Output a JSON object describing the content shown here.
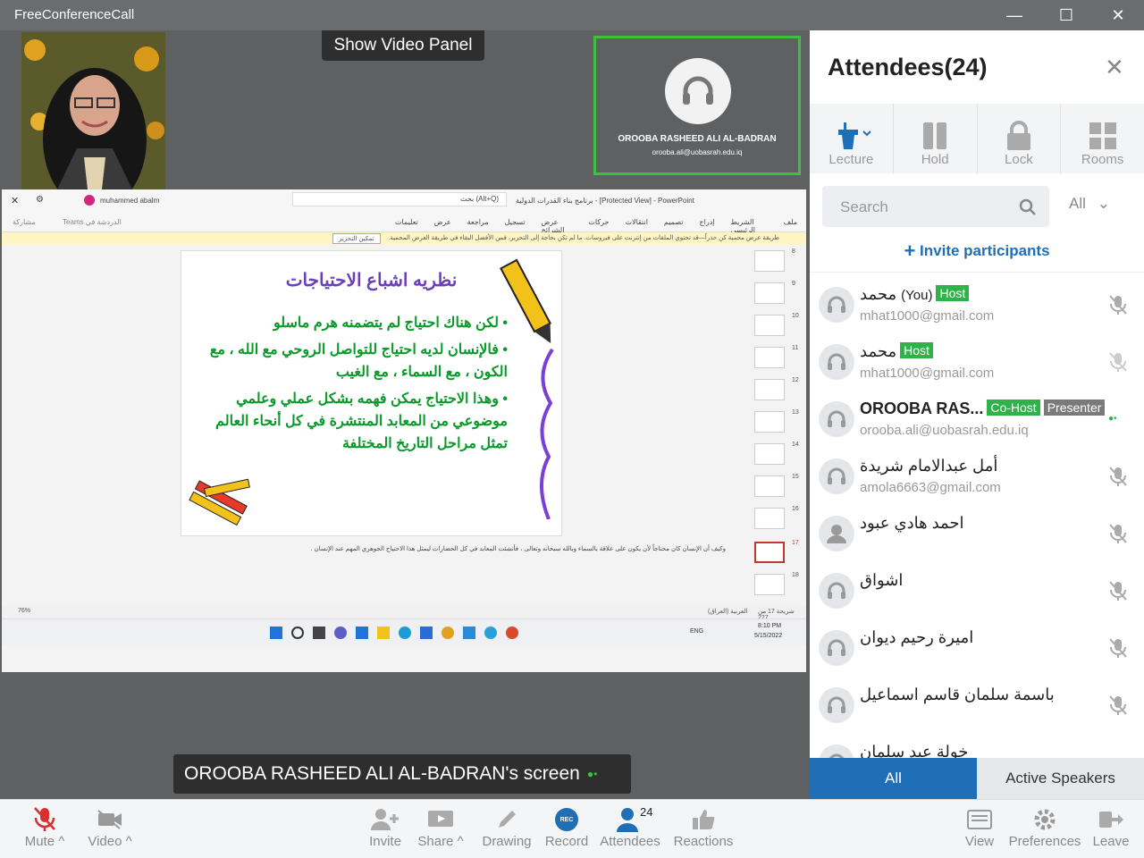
{
  "window": {
    "title": "FreeConferenceCall",
    "minimize": "—",
    "maximize": "☐",
    "close": "✕"
  },
  "stage": {
    "show_video_panel": "Show Video Panel",
    "speaker_name": "OROOBA RASHEED ALI AL-BADRAN",
    "speaker_email": "orooba.ali@uobasrah.edu.iq",
    "screen_label": "OROOBA RASHEED ALI AL-BADRAN's screen"
  },
  "shared": {
    "ppt_title": "برنامج بناء القدرات الدولية  -  [Protected View]  -  PowerPoint",
    "search_hint": "بحث (Alt+Q)",
    "user": "muhammed abalm",
    "ribbon": [
      "ملف",
      "الشريط الرئيسي",
      "إدراج",
      "تصميم",
      "انتقالات",
      "حركات",
      "عرض الشرائح",
      "تسجيل",
      "مراجعة",
      "عرض",
      "تعليمات"
    ],
    "teams": "Teams الدردشة في",
    "share_btn": "مشاركة",
    "warning": "طريقة عرض محمية  كن حذراً—قد تحتوي الملفات من إنترنت على فيروسات. ما لم تكن بحاجة إلى التحرير، فمن الأفضل البقاء في طريقة العرض المحمية.",
    "enable_edit": "تمكين التحرير",
    "slide_title": "نظريه اشباع الاحتياجات",
    "bullets": [
      "• لكن هناك احتياج لم يتضمنه هرم ماسلو",
      "• فالإنسان لديه احتياج للتواصل الروحي مع الله ، مع الكون ، مع السماء ، مع الغيب",
      "• وهذا الاحتياج يمكن فهمه بشكل عملي وعلمي موضوعي من المعابد المنتشرة في كل أنحاء العالم تمثل مراحل التاريخ المختلفة"
    ],
    "notes": "وكيف أن الإنسان كان محتاجاً لأن يكون على علاقة بالسماء وبالله سبحانه وتعالى ، فأنشئت المعابد في كل الحضارات ليمثل هذا الاحتياج الجوهري المهم عند الإنسان .",
    "thumb_numbers": [
      "8",
      "9",
      "10",
      "11",
      "12",
      "13",
      "14",
      "15",
      "16",
      "17",
      "18"
    ],
    "status_left": "شريحة 17 من 227",
    "status_lang": "العربية (العراق)",
    "zoom": "76%",
    "clock_time": "8:10 PM",
    "clock_date": "5/15/2022",
    "lang": "ENG"
  },
  "panel": {
    "title": "Attendees(24)",
    "tools": [
      {
        "label": "Lecture"
      },
      {
        "label": "Hold"
      },
      {
        "label": "Lock"
      },
      {
        "label": "Rooms"
      }
    ],
    "search_placeholder": "Search",
    "filter": "All",
    "invite": "Invite participants",
    "attendees": [
      {
        "name": "محمد",
        "suffix": "(You)",
        "badges": [
          "Host"
        ],
        "email": "mhat1000@gmail.com",
        "muted": true
      },
      {
        "name": "محمد",
        "suffix": "",
        "badges": [
          "Host"
        ],
        "email": "mhat1000@gmail.com",
        "muted": true
      },
      {
        "name": "OROOBA RAS...",
        "suffix": "",
        "badges": [
          "Co-Host",
          "Presenter"
        ],
        "email": "orooba.ali@uobasrah.edu.iq",
        "muted": false
      },
      {
        "name": "أمل عبدالامام شريدة",
        "suffix": "",
        "badges": [],
        "email": "amola6663@gmail.com",
        "muted": true
      },
      {
        "name": "احمد هادي عبود",
        "suffix": "",
        "badges": [],
        "email": "",
        "muted": true
      },
      {
        "name": "اشواق",
        "suffix": "",
        "badges": [],
        "email": "",
        "muted": true
      },
      {
        "name": "اميرة رحيم ديوان",
        "suffix": "",
        "badges": [],
        "email": "",
        "muted": true
      },
      {
        "name": "باسمة سلمان قاسم اسماعيل",
        "suffix": "",
        "badges": [],
        "email": "",
        "muted": true
      },
      {
        "name": "خولة عبد سلمان",
        "suffix": "",
        "badges": [],
        "email": "",
        "muted": true
      }
    ],
    "tabs": {
      "all": "All",
      "active": "Active Speakers"
    }
  },
  "bottombar": {
    "mute": "Mute",
    "video": "Video",
    "invite": "Invite",
    "share": "Share",
    "drawing": "Drawing",
    "record": "Record",
    "rec_badge": "REC",
    "attendees": "Attendees",
    "attendee_count": "24",
    "reactions": "Reactions",
    "view": "View",
    "preferences": "Preferences",
    "leave": "Leave"
  },
  "colors": {
    "host": "#2fb24a",
    "cohost": "#2fb24a",
    "presenter": "#7a7a7a",
    "accent": "#1f6fb6",
    "speaker_border": "#3fbf3f",
    "mute_red": "#d9302f"
  }
}
